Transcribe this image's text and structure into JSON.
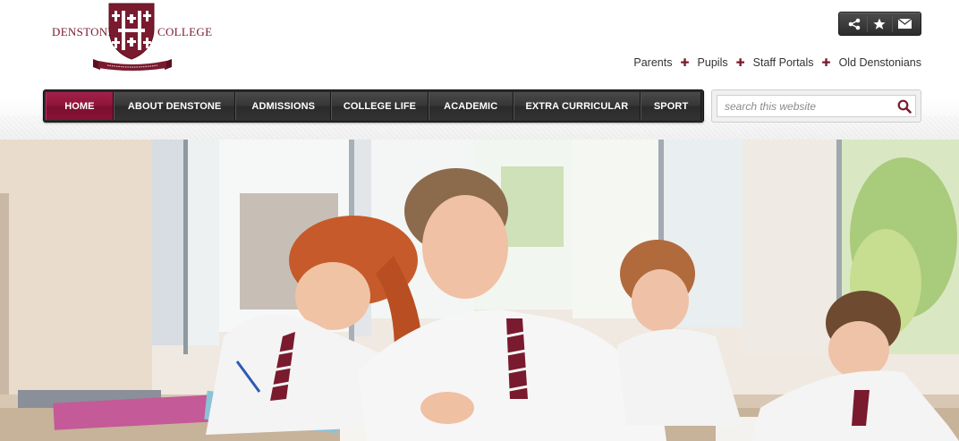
{
  "logo": {
    "left_text": "DENSTONE",
    "right_text": "COLLEGE",
    "banner_text": "LUMEN CUM AMORE CORDIS"
  },
  "utility_icons": [
    "share-icon",
    "star-icon",
    "envelope-icon"
  ],
  "quick_links": [
    {
      "label": "Parents"
    },
    {
      "label": "Pupils"
    },
    {
      "label": "Staff Portals"
    },
    {
      "label": "Old Denstonians"
    }
  ],
  "nav": {
    "items": [
      {
        "label": "HOME",
        "active": true
      },
      {
        "label": "ABOUT DENSTONE",
        "active": false
      },
      {
        "label": "ADMISSIONS",
        "active": false
      },
      {
        "label": "COLLEGE LIFE",
        "active": false
      },
      {
        "label": "ACADEMIC",
        "active": false
      },
      {
        "label": "EXTRA CURRICULAR",
        "active": false
      },
      {
        "label": "SPORT",
        "active": false
      }
    ]
  },
  "search": {
    "placeholder": "search this website",
    "value": ""
  },
  "colors": {
    "brand": "#7a1a2e",
    "nav_active": "#8c1438",
    "nav_bg": "#2a2a2a"
  },
  "hero": {
    "icon": "classroom-photo"
  }
}
